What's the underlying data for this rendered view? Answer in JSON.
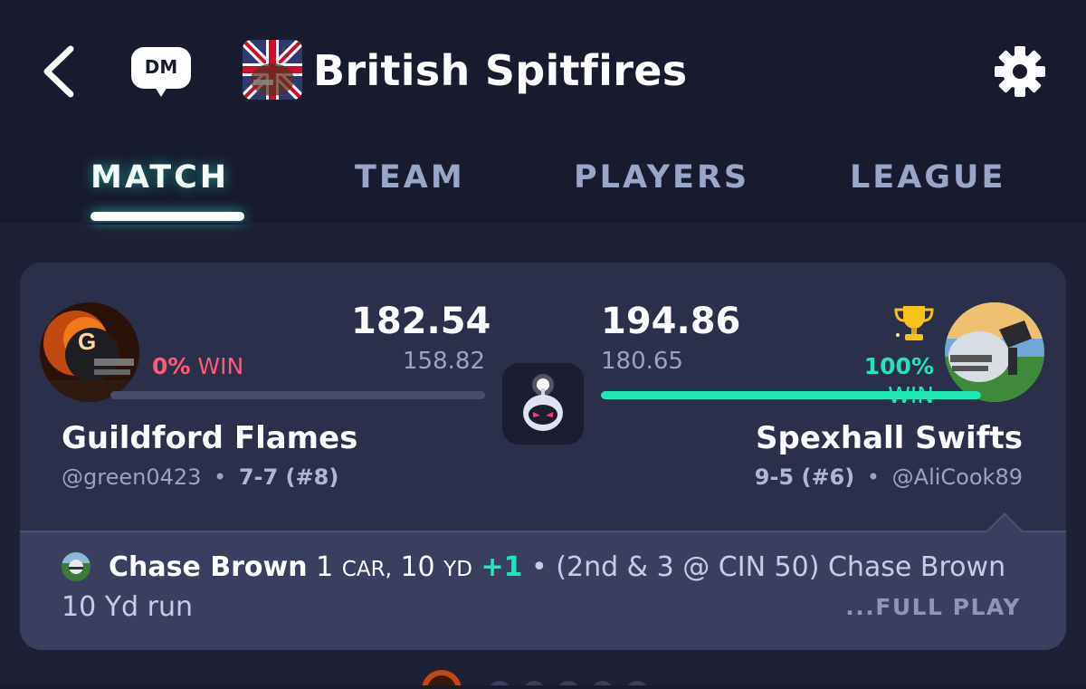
{
  "header": {
    "title": "British Spitfires",
    "dm_label": "DM",
    "icons": [
      "back-arrow-icon",
      "dm-chat-icon",
      "team-logo",
      "gear-icon"
    ]
  },
  "tabs": [
    {
      "label": "MATCH",
      "active": true
    },
    {
      "label": "TEAM",
      "active": false
    },
    {
      "label": "PLAYERS",
      "active": false
    },
    {
      "label": "LEAGUE",
      "active": false
    }
  ],
  "match": {
    "home": {
      "name": "Guildford Flames",
      "handle": "@green0423",
      "record": "7-7 (#8)",
      "score": "182.54",
      "projected": "158.82",
      "win_pct": "0%",
      "win_label": "WIN",
      "win_probability": 0
    },
    "away": {
      "name": "Spexhall Swifts",
      "handle": "@AliCook89",
      "record": "9-5 (#6)",
      "score": "194.86",
      "projected": "180.65",
      "win_pct": "100%",
      "win_label": "WIN",
      "win_probability": 1.0
    },
    "separator": "•",
    "colors": {
      "accent": "#1de9b6",
      "loss": "#ff5a78",
      "background": "#181a2e",
      "card": "#2b2f4a"
    }
  },
  "last_play": {
    "player": "Chase Brown",
    "carries": "1",
    "carries_unit": "CAR,",
    "yards": "10",
    "yards_unit": "YD",
    "points": "+1",
    "separator": "•",
    "description": "(2nd & 3 @ CIN 50) Chase Brown 10 Yd run",
    "full_play_label": "...FULL PLAY"
  }
}
